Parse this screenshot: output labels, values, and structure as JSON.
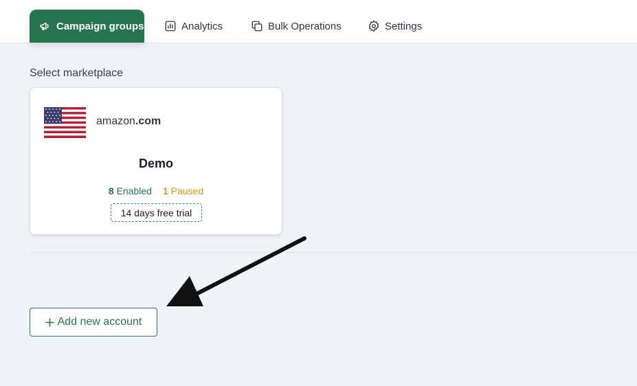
{
  "nav": {
    "tabs": [
      {
        "label": "Campaign groups",
        "icon": "megaphone-icon",
        "active": true
      },
      {
        "label": "Analytics",
        "icon": "bar-chart-icon",
        "active": false
      },
      {
        "label": "Bulk Operations",
        "icon": "copy-icon",
        "active": false
      },
      {
        "label": "Settings",
        "icon": "gear-icon",
        "active": false
      }
    ]
  },
  "main": {
    "section_title": "Select marketplace",
    "card": {
      "flag": "us-flag-icon",
      "marketplace_prefix": "amazon",
      "marketplace_suffix": ".com",
      "account_name": "Demo",
      "enabled_count": "8",
      "enabled_label": "Enabled",
      "paused_count": "1",
      "paused_label": "Paused",
      "trial_badge": "14 days free trial"
    },
    "add_button": {
      "icon": "plus-icon",
      "label": "Add new account"
    }
  },
  "colors": {
    "accent": "#25734f",
    "paused": "#d49a0f",
    "background": "#f0f4f8"
  }
}
